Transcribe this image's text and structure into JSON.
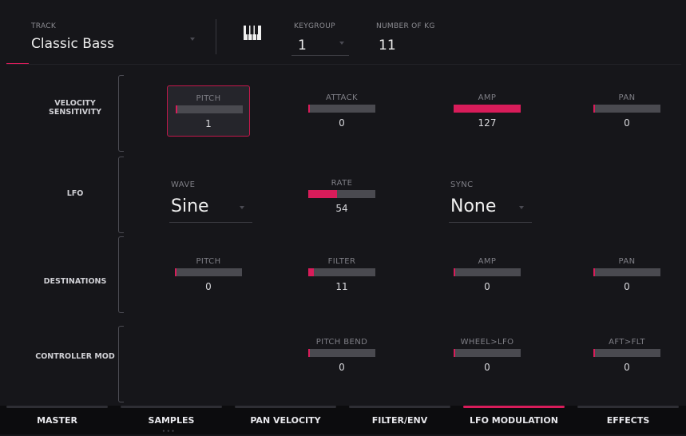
{
  "header": {
    "track_label": "TRACK",
    "track_value": "Classic Bass",
    "keygroup_label": "KEYGROUP",
    "keygroup_value": "1",
    "number_of_kg_label": "NUMBER OF KG",
    "number_of_kg_value": "11"
  },
  "velocity_sensitivity": {
    "label": "VELOCITY SENSITIVITY",
    "params": [
      {
        "label": "PITCH",
        "value": "1",
        "fraction": 0.01,
        "selected": true
      },
      {
        "label": "ATTACK",
        "value": "0",
        "fraction": 0
      },
      {
        "label": "AMP",
        "value": "127",
        "fraction": 1.0
      },
      {
        "label": "PAN",
        "value": "0",
        "fraction": 0
      }
    ]
  },
  "lfo": {
    "label": "LFO",
    "wave_label": "WAVE",
    "wave_value": "Sine",
    "rate_label": "RATE",
    "rate_value": "54",
    "rate_fraction": 0.425,
    "sync_label": "SYNC",
    "sync_value": "None"
  },
  "destinations": {
    "label": "DESTINATIONS",
    "params": [
      {
        "label": "PITCH",
        "value": "0",
        "fraction": 0
      },
      {
        "label": "FILTER",
        "value": "11",
        "fraction": 0.087
      },
      {
        "label": "AMP",
        "value": "0",
        "fraction": 0
      },
      {
        "label": "PAN",
        "value": "0",
        "fraction": 0
      }
    ]
  },
  "controller_mod": {
    "label": "CONTROLLER MOD",
    "params": [
      {
        "label": "PITCH BEND",
        "value": "0",
        "fraction": 0
      },
      {
        "label": "WHEEL>LFO",
        "value": "0",
        "fraction": 0
      },
      {
        "label": "AFT>FLT",
        "value": "0",
        "fraction": 0
      }
    ]
  },
  "tabs": [
    {
      "label": "MASTER",
      "active": false
    },
    {
      "label": "SAMPLES",
      "active": false
    },
    {
      "label": "PAN VELOCITY",
      "active": false
    },
    {
      "label": "FILTER/ENV",
      "active": false
    },
    {
      "label": "LFO MODULATION",
      "active": true
    },
    {
      "label": "EFFECTS",
      "active": false
    }
  ],
  "colors": {
    "accent": "#d81c5a",
    "background": "#16161a",
    "bar_track": "#4a4a50"
  },
  "icons": {
    "keyboard": "piano-keys-icon"
  }
}
